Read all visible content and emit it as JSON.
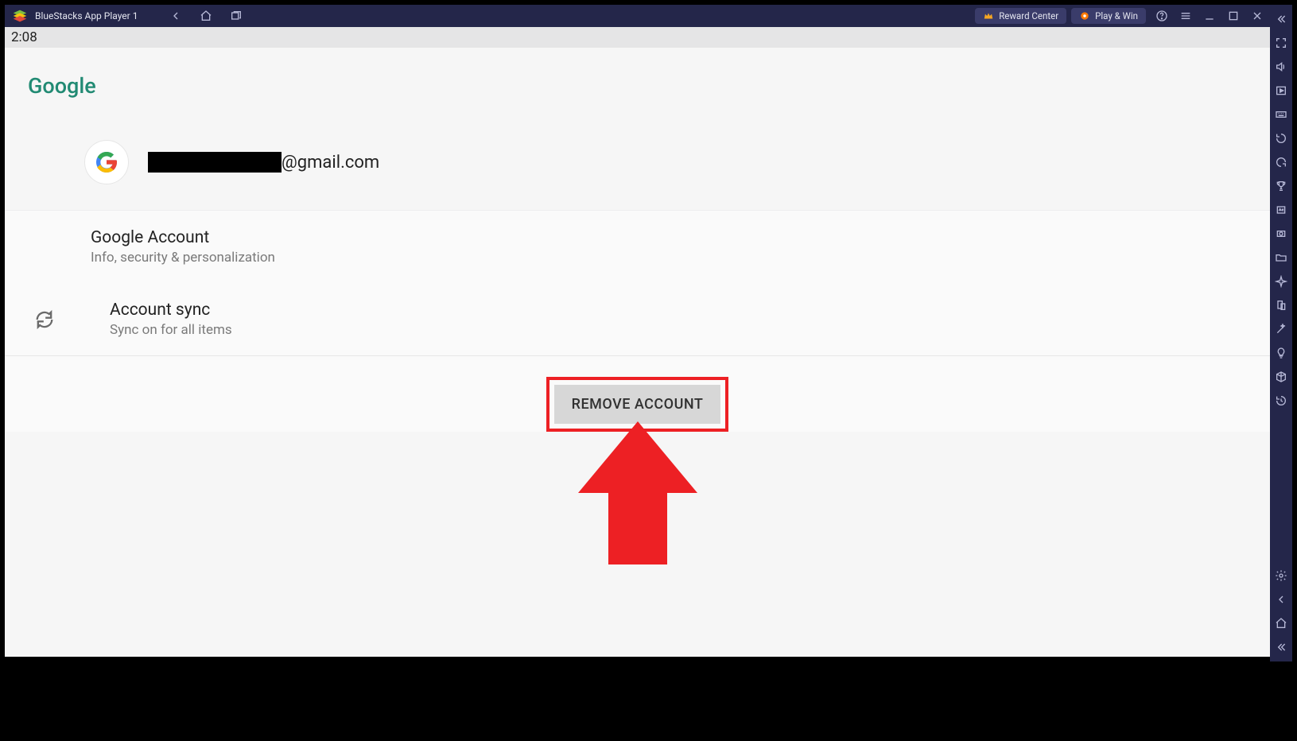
{
  "app": {
    "title": "BlueStacks App Player 1",
    "reward_label": "Reward Center",
    "play_label": "Play & Win"
  },
  "status": {
    "time": "2:08"
  },
  "page": {
    "title": "Google",
    "email_suffix": "@gmail.com"
  },
  "settings": {
    "google_account": {
      "title": "Google Account",
      "sub": "Info, security & personalization"
    },
    "account_sync": {
      "title": "Account sync",
      "sub": "Sync on for all items"
    }
  },
  "actions": {
    "remove_account": "REMOVE ACCOUNT"
  },
  "side_icons": [
    "fullscreen-icon",
    "volume-icon",
    "play-box-icon",
    "keyboard-icon",
    "rotate-ccw-icon",
    "rotate-cw-icon",
    "trophy-icon",
    "apk-icon",
    "camera-target-icon",
    "folder-icon",
    "airplane-icon",
    "devices-icon",
    "wand-icon",
    "lightbulb-icon",
    "cube-icon",
    "history-icon"
  ],
  "side_bottom_icons": [
    "settings-gear-icon",
    "back-arrow-icon",
    "home-nav-icon",
    "collapse-icon"
  ]
}
